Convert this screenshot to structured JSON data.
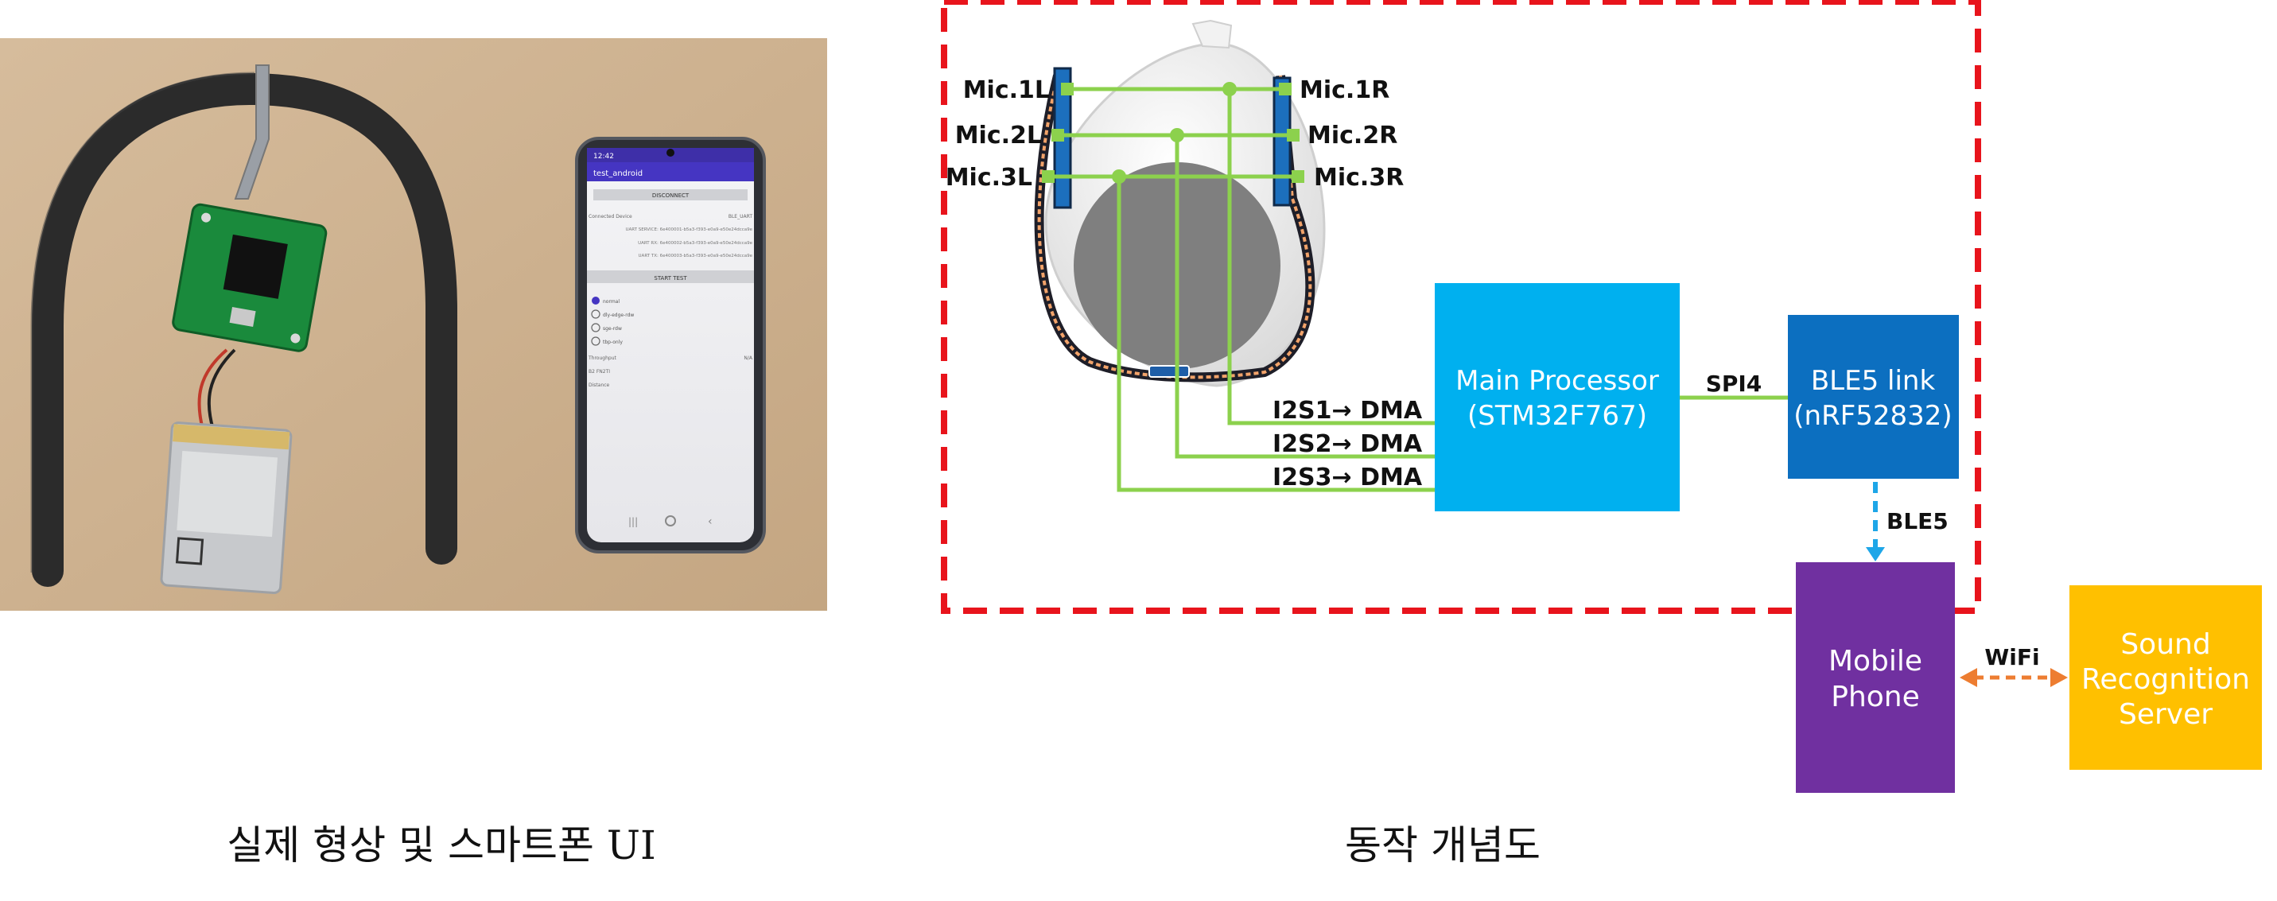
{
  "captions": {
    "left": "실제 형상 및 스마트폰 UI",
    "right": "동작 개념도"
  },
  "phone_ui": {
    "status_time": "12:42",
    "app_title": "test_android",
    "disconnect_button": "DISCONNECT",
    "connected_device_label": "Connected Device",
    "connected_device_value": "BLE_UART",
    "uart_service": "UART SERVICE: 6e400001-b5a3-f393-e0a9-e50e24dcca9e",
    "uart_rx": "UART RX: 6e400002-b5a3-f393-e0a9-e50e24dcca9e",
    "uart_tx": "UART TX: 6e400003-b5a3-f393-e0a9-e50e24dcca9e",
    "start_test_button": "START TEST",
    "radio_options": [
      "normal",
      "dly-edge-rdw",
      "sge-rdw",
      "tbp-only"
    ],
    "throughput_label": "Throughput",
    "throughput_value": "N/A",
    "b2_label": "B2 FN2TI",
    "distance_label": "Distance"
  },
  "diagram": {
    "mics_left": [
      "Mic.1L",
      "Mic.2L",
      "Mic.3L"
    ],
    "mics_right": [
      "Mic.1R",
      "Mic.2R",
      "Mic.3R"
    ],
    "i2s_labels": [
      "I2S1→ DMA",
      "I2S2→ DMA",
      "I2S3→ DMA"
    ],
    "main_processor": {
      "line1": "Main Processor",
      "line2": "(STM32F767)"
    },
    "spi_label": "SPI4",
    "ble_link": {
      "line1": "BLE5 link",
      "line2": "(nRF52832)"
    },
    "ble5_label": "BLE5",
    "mobile_phone": {
      "line1": "Mobile",
      "line2": "Phone"
    },
    "wifi_label": "WiFi",
    "server": {
      "line1": "Sound",
      "line2": "Recognition",
      "line3": "Server"
    }
  },
  "colors": {
    "dashed_border": "#e8141c",
    "wire_green": "#8cd14d",
    "main_processor": "#00b0ef",
    "ble_link": "#0c6fc0",
    "mobile_phone": "#7030a0",
    "server": "#ffc000",
    "ble_arrow": "#1ea6e8",
    "wifi_arrow": "#ed7d31",
    "photo_table": "#cfb393",
    "headband": "#2b2b2b",
    "pcb": "#1a8a3c"
  }
}
